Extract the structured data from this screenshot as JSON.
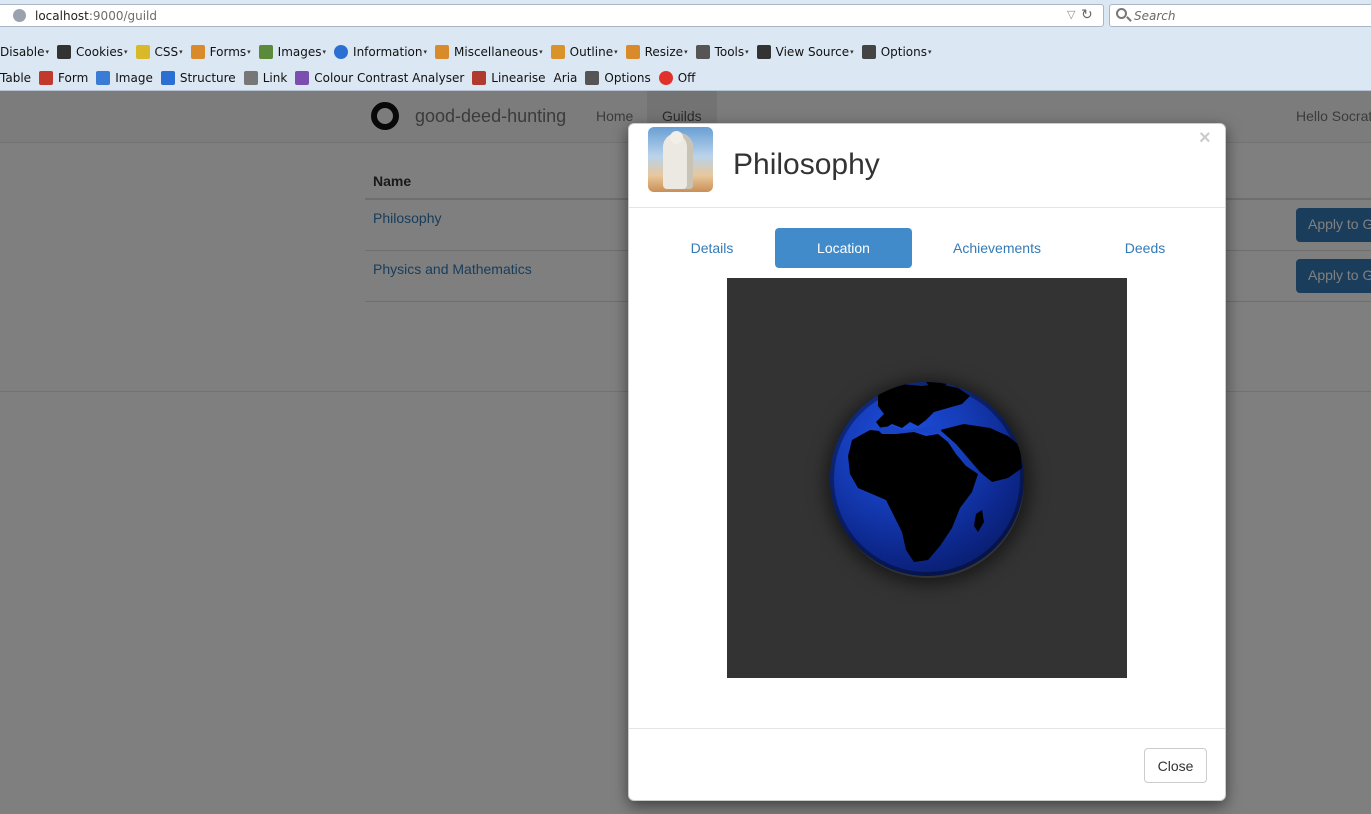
{
  "browser": {
    "url_host": "localhost",
    "url_rest": ":9000/guild",
    "search_placeholder": "Search"
  },
  "toolbar1": [
    {
      "label": "Disable",
      "icon": "disable-icon",
      "color": "",
      "caret": true
    },
    {
      "label": "Cookies",
      "icon": "cookies-icon",
      "color": "#333333",
      "caret": true
    },
    {
      "label": "CSS",
      "icon": "css-icon",
      "color": "#d9b82a",
      "caret": true
    },
    {
      "label": "Forms",
      "icon": "forms-icon",
      "color": "#d98a2a",
      "caret": true
    },
    {
      "label": "Images",
      "icon": "images-icon",
      "color": "#5a8a3a",
      "caret": true
    },
    {
      "label": "Information",
      "icon": "information-icon",
      "color": "#2a6fd1",
      "caret": true
    },
    {
      "label": "Miscellaneous",
      "icon": "miscellaneous-icon",
      "color": "#d98a2a",
      "caret": true
    },
    {
      "label": "Outline",
      "icon": "outline-icon",
      "color": "#d9932a",
      "caret": true
    },
    {
      "label": "Resize",
      "icon": "resize-icon",
      "color": "#d98a2a",
      "caret": true
    },
    {
      "label": "Tools",
      "icon": "tools-icon",
      "color": "#555555",
      "caret": true
    },
    {
      "label": "View Source",
      "icon": "view-source-icon",
      "color": "#333333",
      "caret": true
    },
    {
      "label": "Options",
      "icon": "options-icon",
      "color": "#444444",
      "caret": true
    }
  ],
  "toolbar2": [
    {
      "label": "Table",
      "icon": "",
      "color": ""
    },
    {
      "label": "Form",
      "icon": "form-icon",
      "color": "#c0392b"
    },
    {
      "label": "Image",
      "icon": "image-icon",
      "color": "#3a7bd5"
    },
    {
      "label": "Structure",
      "icon": "structure-icon",
      "color": "#2a6fd1"
    },
    {
      "label": "Link",
      "icon": "link-icon",
      "color": "#777777"
    },
    {
      "label": "Colour Contrast Analyser",
      "icon": "colour-contrast-icon",
      "color": "#7a4fb0"
    },
    {
      "label": "Linearise",
      "icon": "linearise-icon",
      "color": "#b03a2e"
    },
    {
      "label": "Aria",
      "icon": "",
      "color": ""
    },
    {
      "label": "Options",
      "icon": "options-icon",
      "color": "#555555"
    },
    {
      "label": "Off",
      "icon": "off-icon",
      "color": "#e0322b"
    }
  ],
  "navbar": {
    "brand": "good-deed-hunting",
    "home": "Home",
    "guilds": "Guilds",
    "hello": "Hello Socrat"
  },
  "table": {
    "header_name": "Name",
    "rows": [
      {
        "name": "Philosophy",
        "action": "Apply to G"
      },
      {
        "name": "Physics and Mathematics",
        "action": "Apply to G"
      }
    ]
  },
  "modal": {
    "title": "Philosophy",
    "close_x": "×",
    "tabs": [
      "Details",
      "Location",
      "Achievements",
      "Deeds"
    ],
    "active_tab": "Location",
    "close_button": "Close"
  },
  "colors": {
    "accent": "#337ab7",
    "active_tab": "#428bca",
    "globe_ocean": "#153cb8",
    "globe_land": "#000000",
    "globe_panel": "#333333"
  }
}
